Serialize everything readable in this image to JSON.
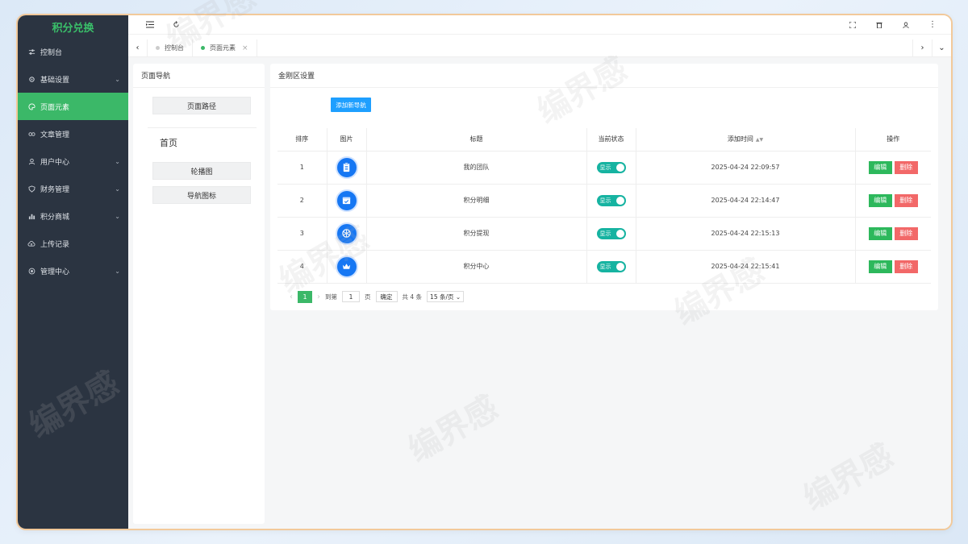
{
  "app": {
    "title": "积分兑换"
  },
  "sidebar": {
    "items": [
      {
        "label": "控制台",
        "icon": "sliders-icon",
        "chevron": false,
        "active": false
      },
      {
        "label": "基础设置",
        "icon": "gear-icon",
        "chevron": true,
        "active": false
      },
      {
        "label": "页面元素",
        "icon": "palette-icon",
        "chevron": false,
        "active": true
      },
      {
        "label": "文章管理",
        "icon": "link-icon",
        "chevron": false,
        "active": false
      },
      {
        "label": "用户中心",
        "icon": "user-icon",
        "chevron": true,
        "active": false
      },
      {
        "label": "财务管理",
        "icon": "shield-icon",
        "chevron": true,
        "active": false
      },
      {
        "label": "积分商城",
        "icon": "bars-icon",
        "chevron": true,
        "active": false
      },
      {
        "label": "上传记录",
        "icon": "cloud-upload-icon",
        "chevron": false,
        "active": false
      },
      {
        "label": "管理中心",
        "icon": "target-icon",
        "chevron": true,
        "active": false
      }
    ]
  },
  "tabs": [
    {
      "label": "控制台",
      "active": false,
      "closable": false
    },
    {
      "label": "页面元素",
      "active": true,
      "closable": true
    }
  ],
  "left_panel": {
    "title": "页面导航",
    "path_button": "页面路径",
    "home_label": "首页",
    "buttons": [
      "轮播图",
      "导航图标"
    ]
  },
  "main_panel": {
    "title": "金刚区设置",
    "add_button": "添加新导航",
    "columns": [
      "排序",
      "图片",
      "标题",
      "当前状态",
      "添加时间",
      "操作"
    ],
    "rows": [
      {
        "order": "1",
        "icon": "clipboard-icon",
        "title": "我的团队",
        "status": "显示",
        "time": "2025-04-24 22:09:57"
      },
      {
        "order": "2",
        "icon": "calendar-check-icon",
        "title": "积分明细",
        "status": "显示",
        "time": "2025-04-24 22:14:47"
      },
      {
        "order": "3",
        "icon": "snowflake-icon",
        "title": "积分提现",
        "status": "显示",
        "time": "2025-04-24 22:15:13"
      },
      {
        "order": "4",
        "icon": "crown-icon",
        "title": "积分中心",
        "status": "显示",
        "time": "2025-04-24 22:15:41"
      }
    ],
    "edit_label": "编辑",
    "delete_label": "删除",
    "pager": {
      "current_page": "1",
      "goto_label": "到第",
      "goto_value": "1",
      "page_unit": "页",
      "confirm_label": "确定",
      "total_label": "共 4 条",
      "page_size": "15 条/页"
    }
  },
  "watermark": "编界感",
  "colors": {
    "sidebar_bg": "#2b3441",
    "accent_green": "#3bb868",
    "primary_blue": "#1e9fff",
    "delete_red": "#f26868",
    "switch_teal": "#16b3a1",
    "frame_border": "#f2c99a"
  }
}
